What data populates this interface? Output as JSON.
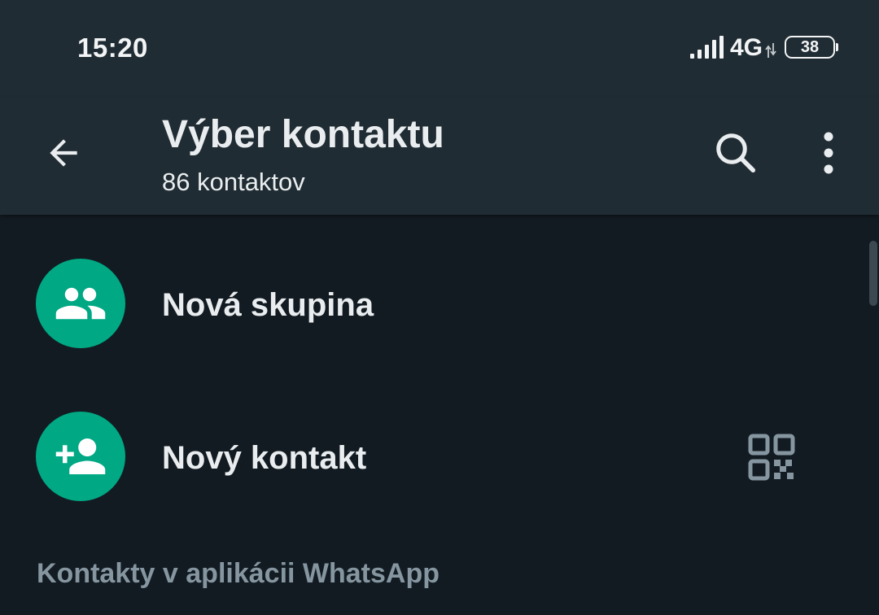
{
  "status_bar": {
    "time": "15:20",
    "network": "4G",
    "battery": "38",
    "icons": [
      "signal-bars-icon",
      "data-arrows-icon",
      "battery-icon"
    ]
  },
  "app_bar": {
    "title": "Výber kontaktu",
    "subtitle": "86 kontaktov",
    "icons": [
      "back-arrow-icon",
      "search-icon",
      "more-vert-icon"
    ]
  },
  "actions": [
    {
      "label": "Nová skupina",
      "icon": "group-icon"
    },
    {
      "label": "Nový kontakt",
      "icon": "person-add-icon",
      "secondary_icon": "qr-code-icon"
    }
  ],
  "section_header": "Kontakty v aplikácii WhatsApp",
  "colors": {
    "accent": "#00a884",
    "app_bar": "#202c33",
    "background": "#121b22",
    "primary_text": "#e9edef",
    "secondary_text": "#8696a0"
  }
}
